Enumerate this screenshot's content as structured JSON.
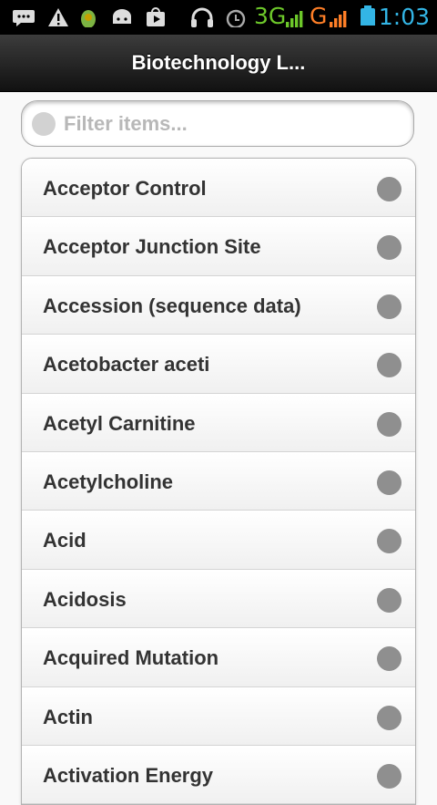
{
  "status_bar": {
    "network_1": "3G",
    "network_2": "G",
    "time": "1:03",
    "colors": {
      "network_1": "#6dc82a",
      "network_2": "#ff7f27",
      "time": "#33b5e5"
    }
  },
  "header": {
    "title": "Biotechnology L..."
  },
  "filter": {
    "placeholder": "Filter items...",
    "value": ""
  },
  "list": {
    "items": [
      {
        "label": "Acceptor Control"
      },
      {
        "label": "Acceptor Junction Site"
      },
      {
        "label": "Accession (sequence data)"
      },
      {
        "label": "Acetobacter aceti"
      },
      {
        "label": "Acetyl Carnitine"
      },
      {
        "label": "Acetylcholine"
      },
      {
        "label": "Acid"
      },
      {
        "label": "Acidosis"
      },
      {
        "label": "Acquired Mutation"
      },
      {
        "label": "Actin"
      },
      {
        "label": "Activation Energy"
      }
    ]
  }
}
